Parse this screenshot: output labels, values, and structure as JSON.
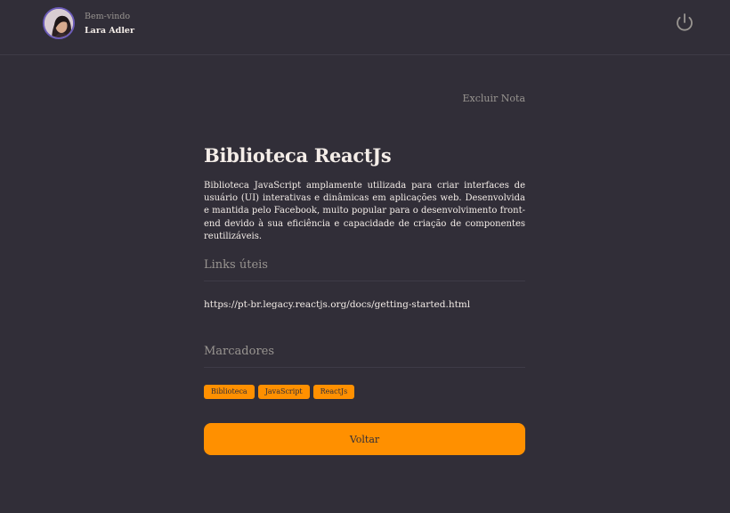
{
  "header": {
    "welcome_label": "Bem-vindo",
    "user_name": "Lara Adler",
    "logout_icon": "power-icon"
  },
  "note": {
    "delete_label": "Excluir Nota",
    "title": "Biblioteca ReactJs",
    "description": "Biblioteca JavaScript amplamente utilizada para criar interfaces de usuário (UI) interativas e dinâmicas em aplicações web. Desenvolvida e mantida pelo Facebook, muito popular para o desenvolvimento front-end devido à sua eficiência e capacidade de criação de componentes reutilizáveis."
  },
  "links": {
    "section_title": "Links úteis",
    "items": [
      "https://pt-br.legacy.reactjs.org/docs/getting-started.html"
    ]
  },
  "tags": {
    "section_title": "Marcadores",
    "items": [
      "Biblioteca",
      "JavaScript",
      "ReactJs"
    ]
  },
  "actions": {
    "back_label": "Voltar"
  },
  "colors": {
    "background": "#312E38",
    "accent": "#FF9000",
    "muted_text": "#999591",
    "divider": "#3E3B47"
  }
}
